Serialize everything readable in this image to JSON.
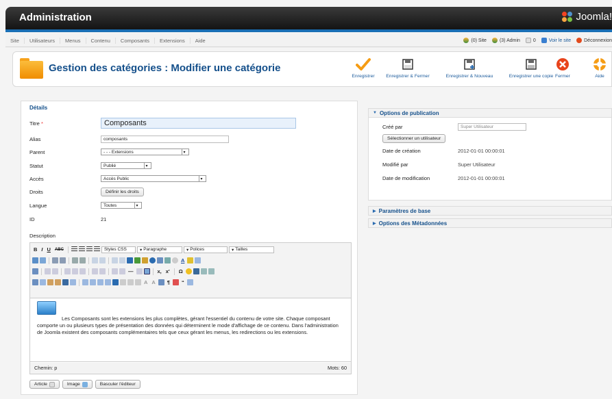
{
  "header": {
    "title": "Administration",
    "logo_text": "Joomla!"
  },
  "menu": [
    "Site",
    "Utilisateurs",
    "Menus",
    "Contenu",
    "Composants",
    "Extensions",
    "Aide"
  ],
  "status": {
    "site": "(0) Site",
    "admin": "(3) Admin",
    "messages": "0",
    "view_site": "Voir le site",
    "logout": "Déconnexion"
  },
  "toolbar": {
    "page_title": "Gestion des catégories : Modifier une catégorie",
    "buttons": [
      "Enregistrer",
      "Enregistrer & Fermer",
      "Enregistrer & Nouveau",
      "Enregistrer une copie",
      "Fermer",
      "Aide"
    ]
  },
  "details": {
    "legend": "Détails",
    "title_label": "Titre",
    "title_value": "Composants",
    "alias_label": "Alias",
    "alias_value": "composants",
    "parent_label": "Parent",
    "parent_value": "- - - Extensions",
    "status_label": "Statut",
    "status_value": "Publié",
    "access_label": "Accès",
    "access_value": "Accès Public",
    "rights_label": "Droits",
    "rights_button": "Définir les droits",
    "language_label": "Langue",
    "language_value": "Toutes",
    "id_label": "ID",
    "id_value": "21",
    "description_label": "Description"
  },
  "editor": {
    "styles": "Styles CSS",
    "format": "Paragraphe",
    "font": "Polices",
    "size": "Tailles",
    "content_line1": "Les Composants sont les extensions les plus complètes, gérant l'essentiel du contenu de votre site. Chaque composant comporte un ou plusieurs types de présentation des données qui déterminent le mode d'affichage de ce contenu. Dans l'administration de Joomla existent des composants complémentaires tels que ceux gérant les menus, les redirections ou les extensions.",
    "path": "Chemin: p",
    "words": "Mots: 60",
    "buttons": [
      "Article",
      "Image",
      "Basculer l'éditeur"
    ]
  },
  "publication": {
    "header": "Options de publication",
    "created_by_label": "Créé par",
    "created_by_value": "Super Utilisateur",
    "select_user_button": "Sélectionner un utilisateur",
    "created_date_label": "Date de création",
    "created_date_value": "2012-01-01 00:00:01",
    "modified_by_label": "Modifié par",
    "modified_by_value": "Super Utilisateur",
    "modified_date_label": "Date de modification",
    "modified_date_value": "2012-01-01 00:00:01"
  },
  "panes": [
    "Paramètres de base",
    "Options des Métadonnées"
  ],
  "colors": {
    "accent": "#15508b",
    "topbar": "#1a1a1a",
    "bluebar": "#1a6fb5"
  }
}
